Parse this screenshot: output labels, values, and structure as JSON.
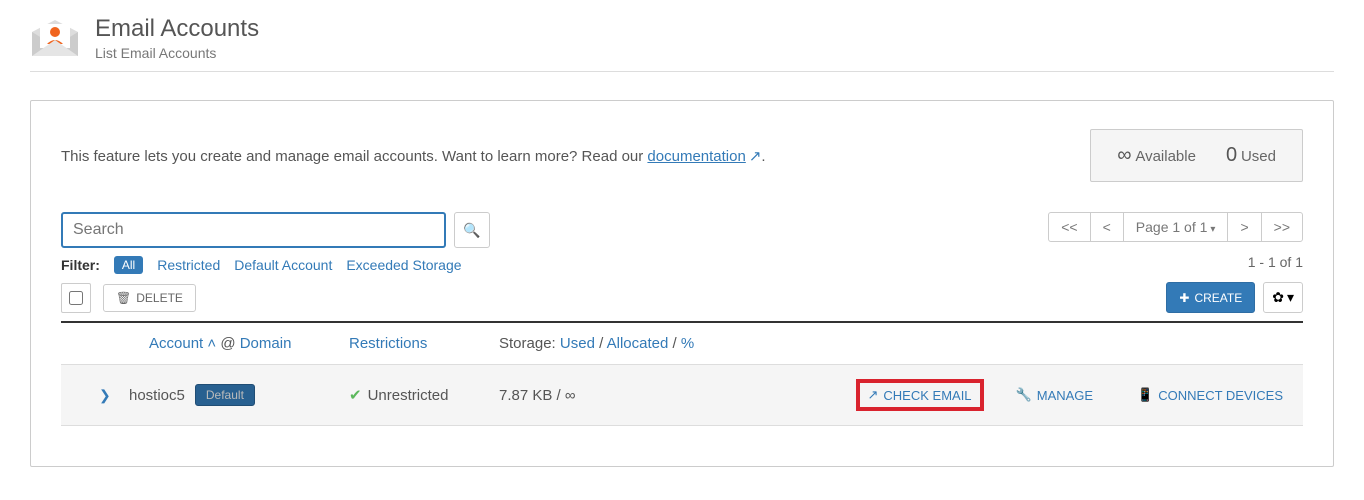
{
  "header": {
    "title": "Email Accounts",
    "subtitle": "List Email Accounts"
  },
  "desc": {
    "text1": "This feature lets you create and manage email accounts. Want to learn more? Read our ",
    "link": "documentation",
    "text2": "."
  },
  "stats": {
    "available_sym": "∞",
    "available_label": "Available",
    "used_val": "0",
    "used_label": "Used"
  },
  "search": {
    "placeholder": "Search"
  },
  "pagination": {
    "first": "<<",
    "prev": "<",
    "page_label": "Page 1 of 1",
    "next": ">",
    "last": ">>"
  },
  "filter": {
    "label": "Filter:",
    "all": "All",
    "restricted": "Restricted",
    "default": "Default Account",
    "exceeded": "Exceeded Storage"
  },
  "count": "1 - 1 of 1",
  "buttons": {
    "delete": "DELETE",
    "create": "CREATE"
  },
  "table": {
    "headers": {
      "account": "Account",
      "at": "@",
      "domain": "Domain",
      "restrictions": "Restrictions",
      "storage": "Storage:",
      "used": "Used",
      "allocated": "Allocated",
      "percent": "%"
    },
    "row": {
      "account": "hostioc5",
      "default_badge": "Default",
      "restriction": "Unrestricted",
      "storage": "7.87 KB / ∞",
      "check_email": "CHECK EMAIL",
      "manage": "MANAGE",
      "connect": "CONNECT DEVICES"
    }
  }
}
